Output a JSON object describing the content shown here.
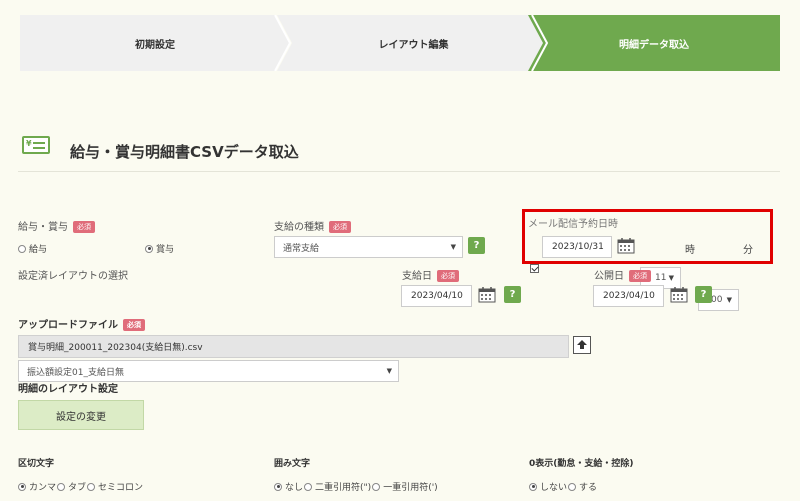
{
  "steps": [
    "初期設定",
    "レイアウト編集",
    "明細データ取込"
  ],
  "page_title": "給与・賞与明細書CSVデータ取込",
  "required_badge": "必須",
  "pay_type": {
    "label": "給与・賞与",
    "options": [
      "給与",
      "賞与"
    ],
    "selected": "賞与"
  },
  "pay_kind": {
    "label": "支給の種類",
    "value": "通常支給"
  },
  "mail_schedule": {
    "label": "メール配信予約日時",
    "checked": true,
    "date": "2023/10/31",
    "hour": "11",
    "hour_unit": "時",
    "minute": "00",
    "minute_unit": "分"
  },
  "layout_select": {
    "label": "設定済レイアウトの選択",
    "value": "振込額設定01_支給日無"
  },
  "pay_date": {
    "label": "支給日",
    "value": "2023/04/10"
  },
  "publish_date": {
    "label": "公開日",
    "value": "2023/04/10"
  },
  "upload_file": {
    "label": "アップロードファイル",
    "value": "賞与明細_200011_202304(支給日無).csv"
  },
  "detail_layout": {
    "label": "明細のレイアウト設定",
    "button": "設定の変更"
  },
  "delimiter": {
    "label": "区切文字",
    "options": [
      "カンマ",
      "タブ",
      "セミコロン"
    ],
    "selected": "カンマ"
  },
  "enclosure": {
    "label": "囲み文字",
    "options": [
      "なし",
      "二重引用符(\")",
      "一重引用符(')"
    ],
    "selected": "なし"
  },
  "zero_display": {
    "label": "0表示(勤怠・支給・控除)",
    "options": [
      "しない",
      "する"
    ],
    "selected": "しない"
  },
  "help_mark": "?",
  "colors": {
    "accent": "#6fa94e",
    "required": "#e06c7a",
    "highlight": "#e00000"
  }
}
